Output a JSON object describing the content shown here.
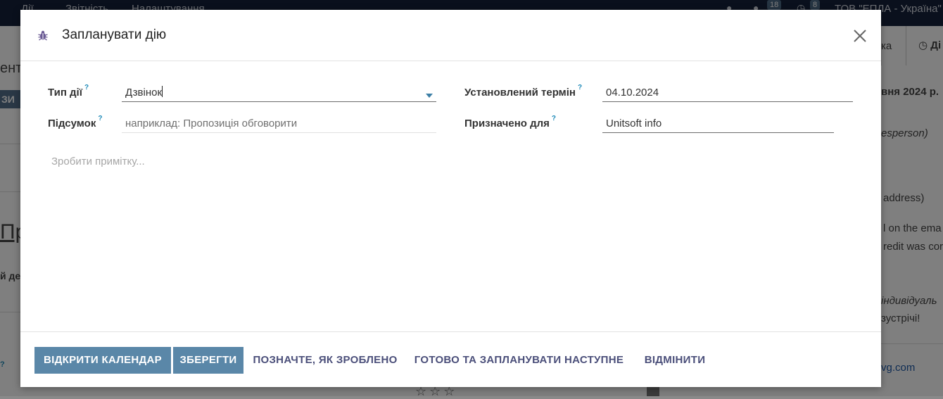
{
  "background": {
    "nav": [
      "Дії",
      "Звітність",
      "Налаштування"
    ],
    "messages_count": "18",
    "activities_count": "8",
    "company": "ТОВ \"ЕПЛА - Україна\"",
    "tab_fragment": "ка",
    "tab_activity": "Ді",
    "breadcrumb_fragment": "ента",
    "pill_fragment": "ЗИ",
    "date_fragment": "вня 2024 р.",
    "salesperson_fragment": "esperson)",
    "address_fragment": "address)",
    "email_fragment": "l on the ema",
    "credit_fragment": "redit was cor",
    "big_title_fragment": "Пре",
    "left_fragment": "й де",
    "individual_fragment": "індивідуаль",
    "meeting_fragment": "зустрічі!",
    "link_fragment": "vg.com",
    "question_mark": "?"
  },
  "modal": {
    "title": "Запланувати дію",
    "fields": {
      "activity_type": {
        "label": "Тип дії",
        "value": "Дзвінок"
      },
      "summary": {
        "label": "Підсумок",
        "placeholder": "наприклад: Пропозиція обговорити"
      },
      "due_date": {
        "label": "Установлений термін",
        "value": "04.10.2024"
      },
      "assigned_to": {
        "label": "Призначено для",
        "value": "Unitsoft info"
      }
    },
    "help_mark": "?",
    "note_placeholder": "Зробити примітку...",
    "buttons": {
      "open_calendar": "ВІДКРИТИ КАЛЕНДАР",
      "save": "ЗБЕРЕГТИ",
      "mark_done": "ПОЗНАЧТЕ, ЯК ЗРОБЛЕНО",
      "done_schedule_next": "ГОТОВО ТА ЗАПЛАНУВАТИ НАСТУПНЕ",
      "cancel": "ВІДМІНИТИ"
    }
  },
  "colors": {
    "primary_button": "#5a87a8",
    "link_button": "#4b4f7a",
    "help_mark": "#1e8ab8",
    "topbar": "#14213a"
  },
  "icons": {
    "modal_icon": "bug-icon",
    "close": "close-icon",
    "dropdown": "chevron-down-icon"
  }
}
